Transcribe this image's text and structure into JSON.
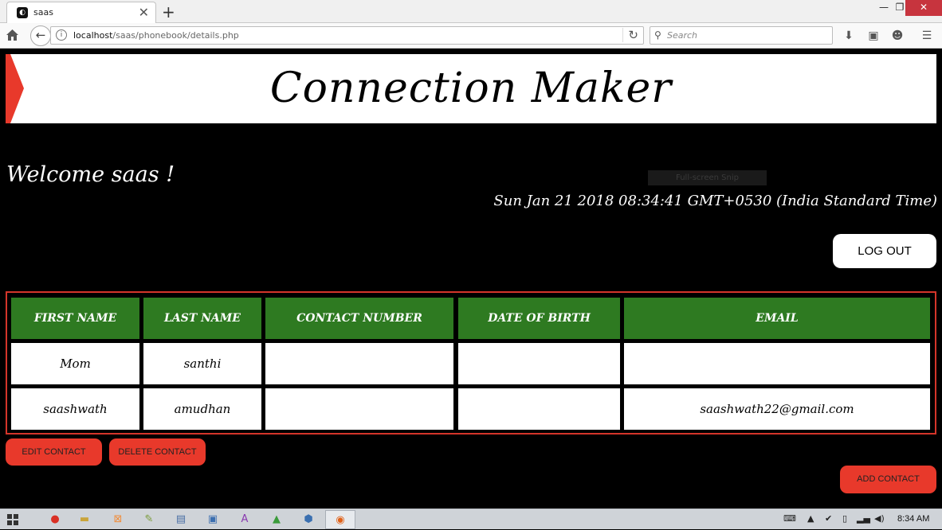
{
  "browser": {
    "tab_title": "saas",
    "tab_close": "✕",
    "new_tab": "+",
    "url_host": "localhost",
    "url_path": "/saas/phonebook/details.php",
    "search_placeholder": "Search"
  },
  "header": {
    "app_title": "Connection Maker",
    "accent_color": "#e8392b"
  },
  "greeting": {
    "welcome": "Welcome saas !",
    "datetime": "Sun Jan 21 2018 08:34:41 GMT+0530 (India Standard Time)",
    "snip_overlay": "Full-screen Snip"
  },
  "actions": {
    "logout": "LOG OUT",
    "edit": "EDIT CONTACT",
    "delete": "DELETE CONTACT",
    "add": "ADD CONTACT"
  },
  "contacts": {
    "header_color": "#2e7a21",
    "columns": [
      "FIRST NAME",
      "LAST NAME",
      "CONTACT NUMBER",
      "DATE OF BIRTH",
      "EMAIL"
    ],
    "rows": [
      [
        "Mom",
        "santhi",
        "",
        "",
        ""
      ],
      [
        "saashwath",
        "amudhan",
        "",
        "",
        "saashwath22@gmail.com"
      ]
    ]
  },
  "taskbar": {
    "clock": "8:34 AM"
  }
}
